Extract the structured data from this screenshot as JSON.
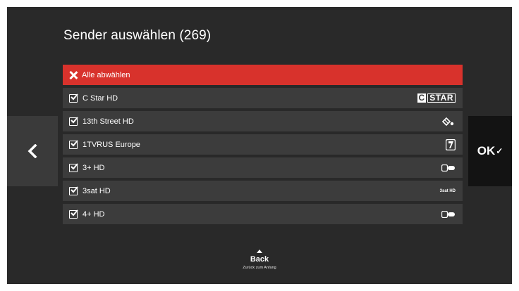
{
  "title": "Sender auswählen (269)",
  "deselect_all": "Alle abwählen",
  "channels": [
    {
      "name": "C Star HD",
      "logo": "cstar"
    },
    {
      "name": "13th Street HD",
      "logo": "13th"
    },
    {
      "name": "1TVRUS Europe",
      "logo": "1tv"
    },
    {
      "name": "3+ HD",
      "logo": "3plus"
    },
    {
      "name": "3sat HD",
      "logo": "3sat"
    },
    {
      "name": "4+ HD",
      "logo": "4plus"
    }
  ],
  "logo_text": {
    "cstar_c": "C",
    "cstar_star": "STAR",
    "threesat": "3sat HD"
  },
  "nav": {
    "ok_label": "OK",
    "left_icon": "chevron-left-icon",
    "ok_icon": "checkmark-icon"
  },
  "back": {
    "label": "Back",
    "sublabel": "Zurück zum Anfang"
  },
  "colors": {
    "accent": "#d8322c",
    "background": "#292929",
    "row": "#3c3c3c"
  }
}
